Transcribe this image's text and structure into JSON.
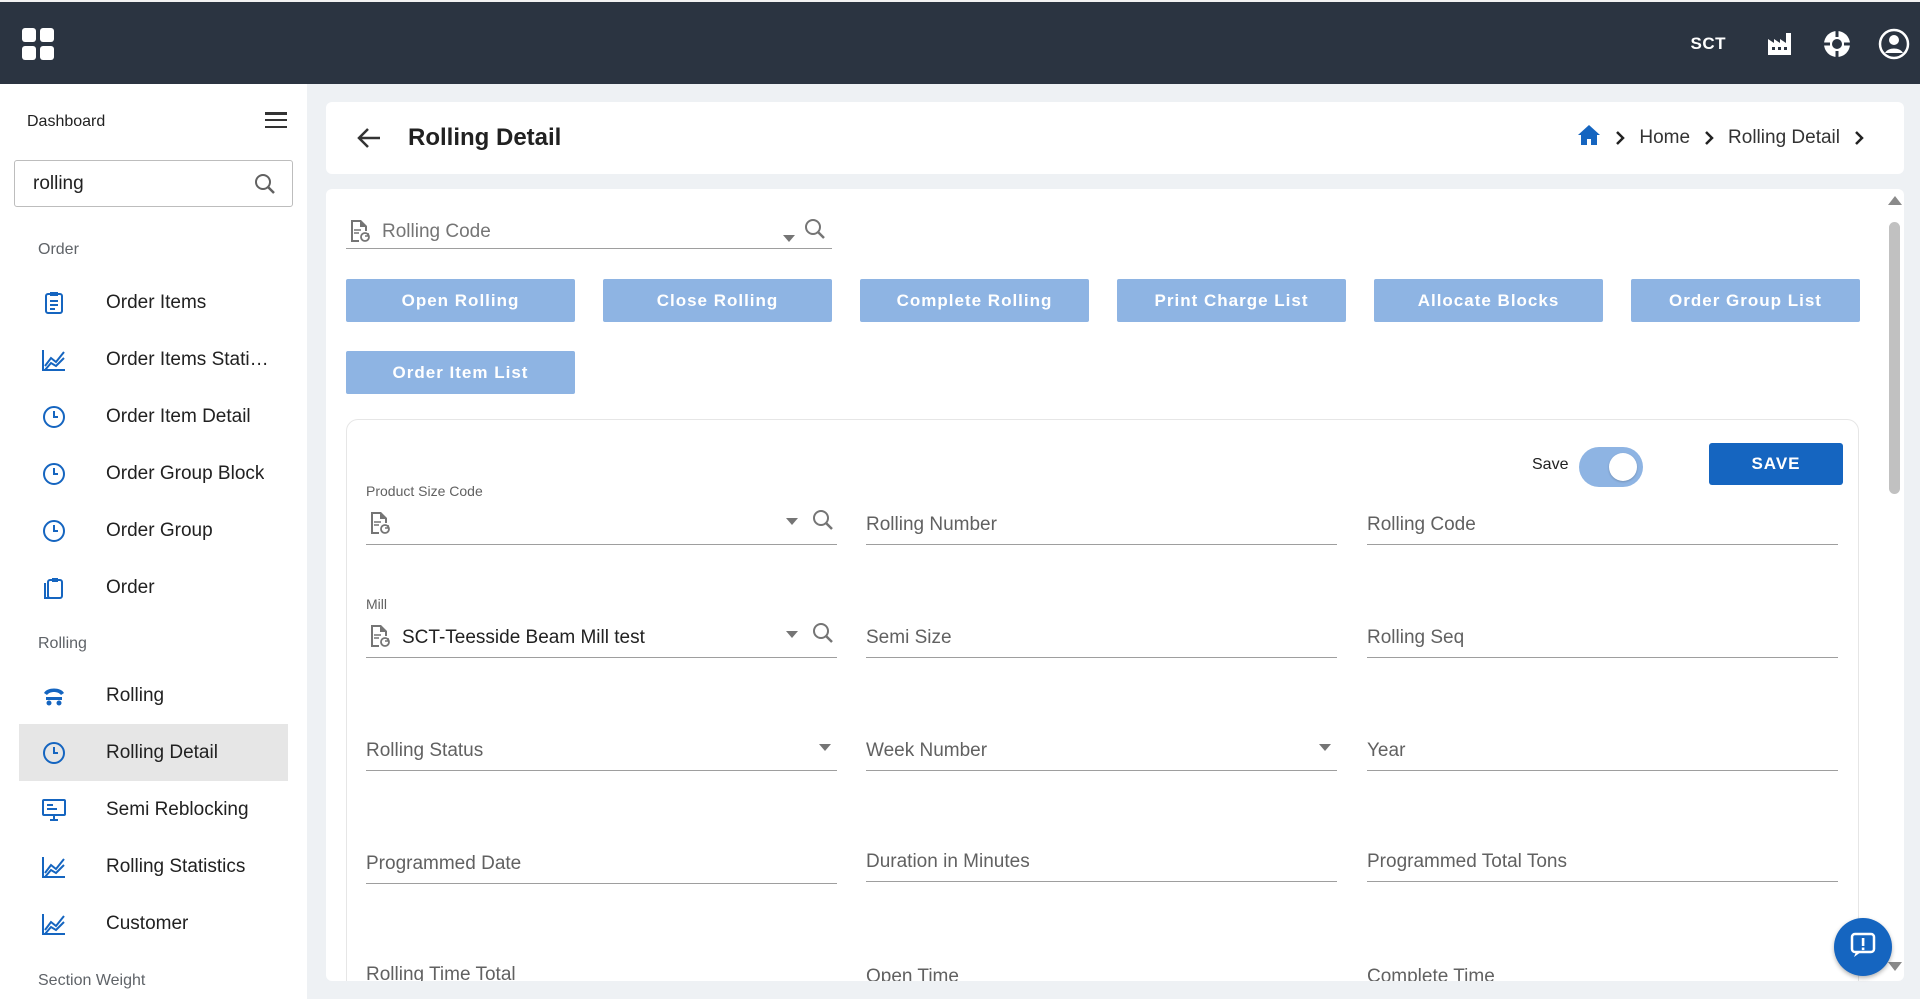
{
  "topbar": {
    "org_code": "SCT"
  },
  "sidebar": {
    "title": "Dashboard",
    "search_value": "rolling",
    "sections": {
      "order": "Order",
      "rolling": "Rolling",
      "section_weight": "Section Weight"
    },
    "items": [
      {
        "label": "Order Items",
        "icon": "clipboard-list-icon"
      },
      {
        "label": "Order Items Statistics",
        "icon": "chart-line-icon"
      },
      {
        "label": "Order Item Detail",
        "icon": "clock-icon"
      },
      {
        "label": "Order Group Block",
        "icon": "clock-icon"
      },
      {
        "label": "Order Group",
        "icon": "clock-icon"
      },
      {
        "label": "Order",
        "icon": "copy-icon"
      },
      {
        "label": "Rolling",
        "icon": "rolling-icon"
      },
      {
        "label": "Rolling Detail",
        "icon": "clock-icon",
        "active": true
      },
      {
        "label": "Semi Reblocking",
        "icon": "monitor-icon"
      },
      {
        "label": "Rolling Statistics",
        "icon": "chart-line-icon"
      },
      {
        "label": "Customer",
        "icon": "chart-line-icon"
      }
    ]
  },
  "header": {
    "title": "Rolling Detail",
    "breadcrumb": [
      "Home",
      "Rolling Detail"
    ]
  },
  "main": {
    "rolling_code_placeholder": "Rolling Code",
    "buttons": [
      "Open Rolling",
      "Close Rolling",
      "Complete Rolling",
      "Print Charge List",
      "Allocate Blocks",
      "Order Group List",
      "Order Item List"
    ],
    "save_toggle_label": "Save",
    "save_button": "SAVE",
    "fields": {
      "product_size_code": {
        "label": "Product Size Code",
        "value": ""
      },
      "rolling_number": "Rolling Number",
      "rolling_code": "Rolling Code",
      "mill": {
        "label": "Mill",
        "value": "SCT-Teesside Beam Mill test"
      },
      "semi_size": "Semi Size",
      "rolling_seq": "Rolling Seq",
      "rolling_status": "Rolling Status",
      "week_number": "Week Number",
      "year": "Year",
      "programmed_date": "Programmed Date",
      "duration_in_minutes": "Duration in Minutes",
      "programmed_total_tons": "Programmed Total Tons",
      "rolling_time_total": "Rolling Time Total",
      "open_time": "Open Time",
      "complete_time": "Complete Time"
    }
  },
  "colors": {
    "topbar": "#2b3441",
    "accent": "#1565c0",
    "button_light": "#8eb4e3"
  }
}
